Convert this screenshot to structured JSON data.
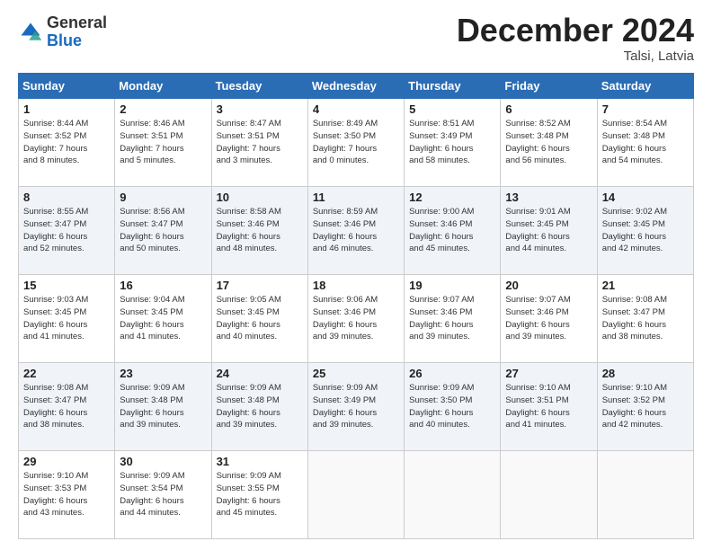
{
  "header": {
    "logo_general": "General",
    "logo_blue": "Blue",
    "month_title": "December 2024",
    "location": "Talsi, Latvia"
  },
  "days_of_week": [
    "Sunday",
    "Monday",
    "Tuesday",
    "Wednesday",
    "Thursday",
    "Friday",
    "Saturday"
  ],
  "weeks": [
    [
      {
        "day": "1",
        "lines": [
          "Sunrise: 8:44 AM",
          "Sunset: 3:52 PM",
          "Daylight: 7 hours",
          "and 8 minutes."
        ]
      },
      {
        "day": "2",
        "lines": [
          "Sunrise: 8:46 AM",
          "Sunset: 3:51 PM",
          "Daylight: 7 hours",
          "and 5 minutes."
        ]
      },
      {
        "day": "3",
        "lines": [
          "Sunrise: 8:47 AM",
          "Sunset: 3:51 PM",
          "Daylight: 7 hours",
          "and 3 minutes."
        ]
      },
      {
        "day": "4",
        "lines": [
          "Sunrise: 8:49 AM",
          "Sunset: 3:50 PM",
          "Daylight: 7 hours",
          "and 0 minutes."
        ]
      },
      {
        "day": "5",
        "lines": [
          "Sunrise: 8:51 AM",
          "Sunset: 3:49 PM",
          "Daylight: 6 hours",
          "and 58 minutes."
        ]
      },
      {
        "day": "6",
        "lines": [
          "Sunrise: 8:52 AM",
          "Sunset: 3:48 PM",
          "Daylight: 6 hours",
          "and 56 minutes."
        ]
      },
      {
        "day": "7",
        "lines": [
          "Sunrise: 8:54 AM",
          "Sunset: 3:48 PM",
          "Daylight: 6 hours",
          "and 54 minutes."
        ]
      }
    ],
    [
      {
        "day": "8",
        "lines": [
          "Sunrise: 8:55 AM",
          "Sunset: 3:47 PM",
          "Daylight: 6 hours",
          "and 52 minutes."
        ]
      },
      {
        "day": "9",
        "lines": [
          "Sunrise: 8:56 AM",
          "Sunset: 3:47 PM",
          "Daylight: 6 hours",
          "and 50 minutes."
        ]
      },
      {
        "day": "10",
        "lines": [
          "Sunrise: 8:58 AM",
          "Sunset: 3:46 PM",
          "Daylight: 6 hours",
          "and 48 minutes."
        ]
      },
      {
        "day": "11",
        "lines": [
          "Sunrise: 8:59 AM",
          "Sunset: 3:46 PM",
          "Daylight: 6 hours",
          "and 46 minutes."
        ]
      },
      {
        "day": "12",
        "lines": [
          "Sunrise: 9:00 AM",
          "Sunset: 3:46 PM",
          "Daylight: 6 hours",
          "and 45 minutes."
        ]
      },
      {
        "day": "13",
        "lines": [
          "Sunrise: 9:01 AM",
          "Sunset: 3:45 PM",
          "Daylight: 6 hours",
          "and 44 minutes."
        ]
      },
      {
        "day": "14",
        "lines": [
          "Sunrise: 9:02 AM",
          "Sunset: 3:45 PM",
          "Daylight: 6 hours",
          "and 42 minutes."
        ]
      }
    ],
    [
      {
        "day": "15",
        "lines": [
          "Sunrise: 9:03 AM",
          "Sunset: 3:45 PM",
          "Daylight: 6 hours",
          "and 41 minutes."
        ]
      },
      {
        "day": "16",
        "lines": [
          "Sunrise: 9:04 AM",
          "Sunset: 3:45 PM",
          "Daylight: 6 hours",
          "and 41 minutes."
        ]
      },
      {
        "day": "17",
        "lines": [
          "Sunrise: 9:05 AM",
          "Sunset: 3:45 PM",
          "Daylight: 6 hours",
          "and 40 minutes."
        ]
      },
      {
        "day": "18",
        "lines": [
          "Sunrise: 9:06 AM",
          "Sunset: 3:46 PM",
          "Daylight: 6 hours",
          "and 39 minutes."
        ]
      },
      {
        "day": "19",
        "lines": [
          "Sunrise: 9:07 AM",
          "Sunset: 3:46 PM",
          "Daylight: 6 hours",
          "and 39 minutes."
        ]
      },
      {
        "day": "20",
        "lines": [
          "Sunrise: 9:07 AM",
          "Sunset: 3:46 PM",
          "Daylight: 6 hours",
          "and 39 minutes."
        ]
      },
      {
        "day": "21",
        "lines": [
          "Sunrise: 9:08 AM",
          "Sunset: 3:47 PM",
          "Daylight: 6 hours",
          "and 38 minutes."
        ]
      }
    ],
    [
      {
        "day": "22",
        "lines": [
          "Sunrise: 9:08 AM",
          "Sunset: 3:47 PM",
          "Daylight: 6 hours",
          "and 38 minutes."
        ]
      },
      {
        "day": "23",
        "lines": [
          "Sunrise: 9:09 AM",
          "Sunset: 3:48 PM",
          "Daylight: 6 hours",
          "and 39 minutes."
        ]
      },
      {
        "day": "24",
        "lines": [
          "Sunrise: 9:09 AM",
          "Sunset: 3:48 PM",
          "Daylight: 6 hours",
          "and 39 minutes."
        ]
      },
      {
        "day": "25",
        "lines": [
          "Sunrise: 9:09 AM",
          "Sunset: 3:49 PM",
          "Daylight: 6 hours",
          "and 39 minutes."
        ]
      },
      {
        "day": "26",
        "lines": [
          "Sunrise: 9:09 AM",
          "Sunset: 3:50 PM",
          "Daylight: 6 hours",
          "and 40 minutes."
        ]
      },
      {
        "day": "27",
        "lines": [
          "Sunrise: 9:10 AM",
          "Sunset: 3:51 PM",
          "Daylight: 6 hours",
          "and 41 minutes."
        ]
      },
      {
        "day": "28",
        "lines": [
          "Sunrise: 9:10 AM",
          "Sunset: 3:52 PM",
          "Daylight: 6 hours",
          "and 42 minutes."
        ]
      }
    ],
    [
      {
        "day": "29",
        "lines": [
          "Sunrise: 9:10 AM",
          "Sunset: 3:53 PM",
          "Daylight: 6 hours",
          "and 43 minutes."
        ]
      },
      {
        "day": "30",
        "lines": [
          "Sunrise: 9:09 AM",
          "Sunset: 3:54 PM",
          "Daylight: 6 hours",
          "and 44 minutes."
        ]
      },
      {
        "day": "31",
        "lines": [
          "Sunrise: 9:09 AM",
          "Sunset: 3:55 PM",
          "Daylight: 6 hours",
          "and 45 minutes."
        ]
      },
      null,
      null,
      null,
      null
    ]
  ],
  "colors": {
    "header_bg": "#2a6db5",
    "accent": "#1a6bbf"
  }
}
